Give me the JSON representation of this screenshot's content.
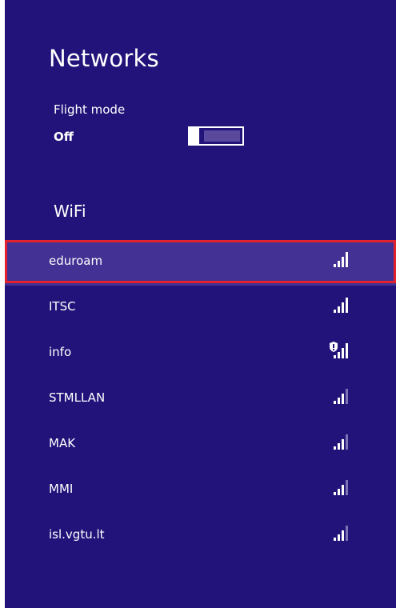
{
  "panel": {
    "title": "Networks",
    "background": "#22137a",
    "highlight_color": "#e0232e"
  },
  "flight_mode": {
    "label": "Flight mode",
    "state": "Off",
    "enabled": false
  },
  "wifi": {
    "section_label": "WiFi",
    "networks": [
      {
        "name": "eduroam",
        "secured": false,
        "strength": 4,
        "selected": true
      },
      {
        "name": "ITSC",
        "secured": false,
        "strength": 4,
        "selected": false
      },
      {
        "name": "info",
        "secured": true,
        "strength": 4,
        "selected": false
      },
      {
        "name": "STMLLAN",
        "secured": false,
        "strength": 3,
        "selected": false
      },
      {
        "name": "MAK",
        "secured": false,
        "strength": 3,
        "selected": false
      },
      {
        "name": "MMI",
        "secured": false,
        "strength": 3,
        "selected": false
      },
      {
        "name": "isl.vgtu.lt",
        "secured": false,
        "strength": 3,
        "selected": false
      }
    ]
  },
  "icons": {
    "signal": "wifi-signal-icon",
    "shield": "shield-warning-icon"
  }
}
